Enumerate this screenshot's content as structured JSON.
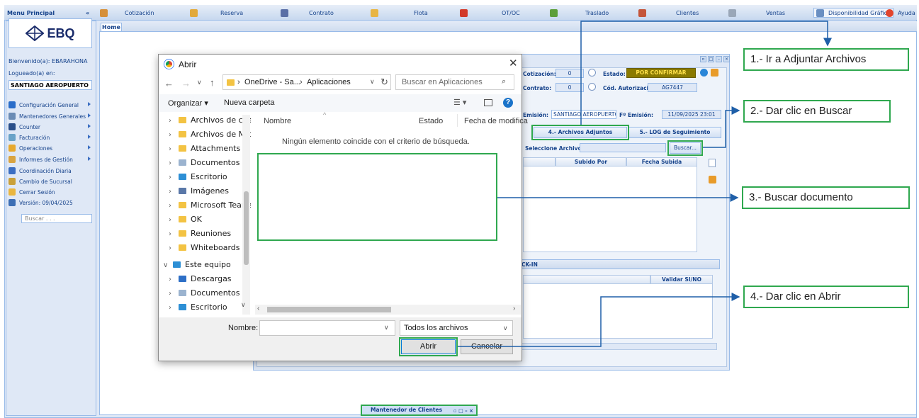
{
  "topbar": {
    "menu_principal": "Menu Principal",
    "collapse": "«",
    "items": [
      "Cotización",
      "Reserva",
      "Contrato",
      "Flota",
      "OT/OC",
      "Traslado",
      "Clientes",
      "Ventas"
    ],
    "disponibilidad": "Disponibilidad Gráfica",
    "ayuda": "Ayuda"
  },
  "sidebar": {
    "logo": "EBQ",
    "welcome": "Bienvenido(a): EBARAHONA",
    "logged_label": "Logueado(a) en:",
    "location": "SANTIAGO AEROPUERTO",
    "menu": [
      {
        "label": "Configuración General",
        "icon": "config-icon",
        "color": "#2a6dc9"
      },
      {
        "label": "Mantenedores Generales",
        "icon": "maintainers-icon",
        "color": "#6b8cb5"
      },
      {
        "label": "Counter",
        "icon": "counter-icon",
        "color": "#2a4f8a"
      },
      {
        "label": "Facturación",
        "icon": "invoice-icon",
        "color": "#6aa3c8"
      },
      {
        "label": "Operaciones",
        "icon": "operations-icon",
        "color": "#e7a92f"
      },
      {
        "label": "Informes de Gestión",
        "icon": "reports-icon",
        "color": "#d9a441"
      },
      {
        "label": "Coordinación Diaria",
        "icon": "coordination-icon",
        "color": "#3b6ec2"
      },
      {
        "label": "Cambio de Sucursal",
        "icon": "branch-icon",
        "color": "#c9a03a"
      },
      {
        "label": "Cerrar Sesión",
        "icon": "logout-icon",
        "color": "#e9b640"
      },
      {
        "label": "Versión: 09/04/2025",
        "icon": "version-icon",
        "color": "#3d6fb5"
      }
    ],
    "search_placeholder": "Buscar . . ."
  },
  "tabs": {
    "home": "Home"
  },
  "background_window": {
    "cotizacion_label": "Cotización:",
    "cotizacion_value": "0",
    "estado_label": "Estado:",
    "estado_value": "POR CONFIRMAR",
    "contrato_label": "Contrato:",
    "contrato_value": "0",
    "autorizacion_label": "Cód. Autorización:",
    "autorizacion_value": "AG7447",
    "emision_label": "Emisión:",
    "emision_value": "SANTIAGO AEROPUERTO",
    "fecha_emision_label": "Fº Emisión:",
    "fecha_emision_value": "11/09/2025 23:01",
    "tab_archivos": "4.- Archivos Adjuntos",
    "tab_log": "5.- LOG de Seguimiento",
    "seleccione_label": "Seleccione Archivo:",
    "buscar_button": "Buscar...",
    "col_subido": "Subido Por",
    "col_fecha": "Fecha Subida",
    "checkin_title": "CK-IN",
    "col_validar": "Validar SI/NO"
  },
  "dialog": {
    "title": "Abrir",
    "breadcrumb": [
      "OneDrive - Sa...",
      "Aplicaciones"
    ],
    "search_placeholder": "Buscar en Aplicaciones",
    "organizar": "Organizar",
    "nueva_carpeta": "Nueva carpeta",
    "col_nombre": "Nombre",
    "col_estado": "Estado",
    "col_fecha": "Fecha de modifica",
    "empty_message": "Ningún elemento coincide con el criterio de búsqueda.",
    "tree": [
      "Archivos de chat",
      "Archivos de Micr",
      "Attachments",
      "Documentos",
      "Escritorio",
      "Imágenes",
      "Microsoft Teams",
      "OK",
      "Reuniones",
      "Whiteboards"
    ],
    "este_equipo": "Este equipo",
    "tree2": [
      "Descargas",
      "Documentos",
      "Escritorio"
    ],
    "nombre_label": "Nombre:",
    "nombre_value": "",
    "filter": "Todos los archivos",
    "abrir": "Abrir",
    "cancelar": "Cancelar"
  },
  "callouts": {
    "c1": "1.- Ir a Adjuntar Archivos",
    "c2": "2.- Dar clic en Buscar",
    "c3": "3.- Buscar documento",
    "c4": "4.- Dar clic en Abrir"
  },
  "bottom_taskbar": "Mantenedor de Clientes",
  "colors": {
    "annotation_green": "#2fa84f",
    "arrow_blue": "#1f5fa8",
    "estado_bg": "#8a7a00",
    "estado_text": "#ffe14a"
  }
}
